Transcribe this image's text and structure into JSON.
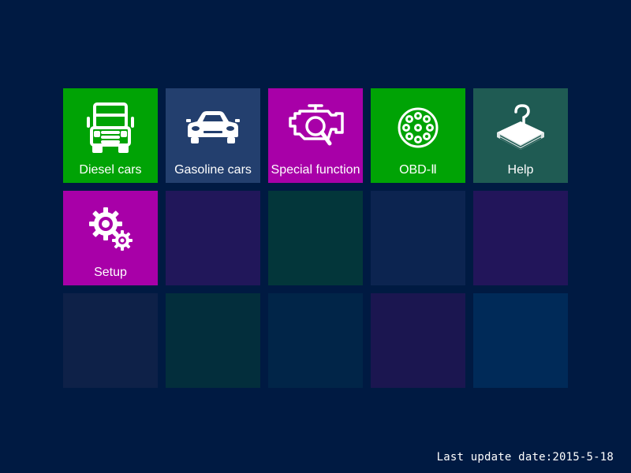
{
  "tiles": [
    {
      "label": "Diesel cars",
      "icon": "truck-icon",
      "color": "#00a305"
    },
    {
      "label": "Gasoline cars",
      "icon": "car-icon",
      "color": "#233f6e"
    },
    {
      "label": "Special function",
      "icon": "engine-search-icon",
      "color": "#a800a8"
    },
    {
      "label": "OBD-Ⅱ",
      "icon": "obd-connector-icon",
      "color": "#00a305"
    },
    {
      "label": "Help",
      "icon": "help-book-icon",
      "color": "#1f5b53"
    },
    {
      "label": "Setup",
      "icon": "gears-icon",
      "color": "#a800a8"
    }
  ],
  "empty_tile_colors": [
    "#21175a",
    "#03363a",
    "#0c2450",
    "#22155a",
    "#0e2148",
    "#032e3c",
    "#012548",
    "#1b1650",
    "#002a58"
  ],
  "footer": {
    "last_update": "Last update date:2015-5-18"
  }
}
